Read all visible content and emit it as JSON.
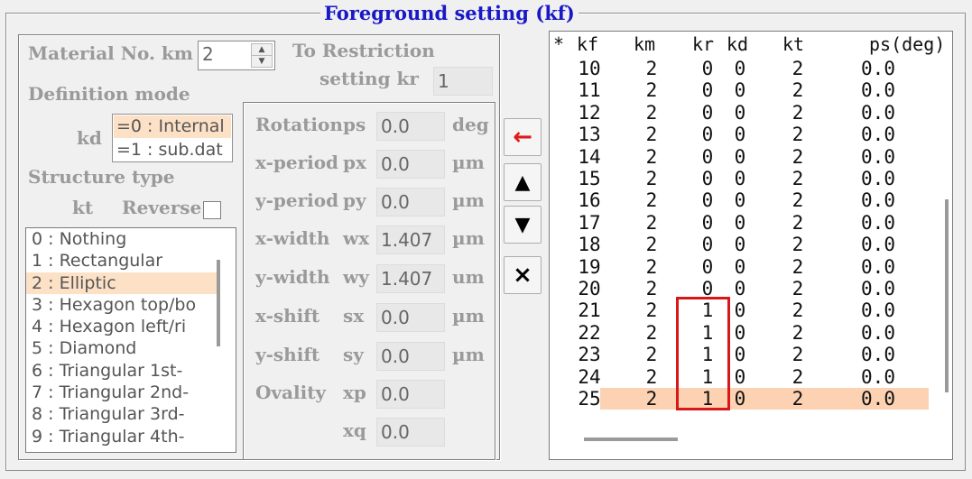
{
  "group_title": "Foreground setting (kf)",
  "material": {
    "label": "Material No.  km",
    "value": "2"
  },
  "restriction": {
    "label1": "To Restriction",
    "label2": "setting  kr",
    "value": "1"
  },
  "definition": {
    "label": "Definition mode",
    "kd_label": "kd",
    "opt0": "=0 : Internal",
    "opt1": "=1 : sub.dat"
  },
  "structure": {
    "label": "Structure type",
    "kt_label": "kt",
    "reverse_label": "Reverse"
  },
  "shape_list": [
    "0 : Nothing",
    "1 : Rectangular",
    "2 : Elliptic",
    "3 : Hexagon top/bo",
    "4 : Hexagon left/ri",
    "5 : Diamond",
    "6 : Triangular 1st-",
    "7 : Triangular 2nd-",
    "8 : Triangular 3rd-",
    "9 : Triangular 4th-"
  ],
  "params": [
    {
      "name": "Rotation",
      "sym": "ps",
      "value": "0.0",
      "unit": "deg"
    },
    {
      "name": "x-period",
      "sym": "px",
      "value": "0.0",
      "unit": "µm"
    },
    {
      "name": "y-period",
      "sym": "py",
      "value": "0.0",
      "unit": "µm"
    },
    {
      "name": "x-width",
      "sym": "wx",
      "value": "1.407",
      "unit": "µm"
    },
    {
      "name": "y-width",
      "sym": "wy",
      "value": "1.407",
      "unit": "um"
    },
    {
      "name": "x-shift",
      "sym": "sx",
      "value": "0.0",
      "unit": "µm"
    },
    {
      "name": "y-shift",
      "sym": "sy",
      "value": "0.0",
      "unit": "µm"
    },
    {
      "name": "Ovality",
      "sym": "xp",
      "value": "0.0",
      "unit": ""
    },
    {
      "name": "",
      "sym": "xq",
      "value": "0.0",
      "unit": ""
    }
  ],
  "buttons": {
    "left": "←",
    "up": "▲",
    "down": "▼",
    "delete": "×"
  },
  "table": {
    "headers": [
      "*",
      "kf",
      "km",
      "kr",
      "kd",
      "kt",
      "ps(deg)"
    ],
    "rows": [
      [
        "10",
        "2",
        "0",
        "0",
        "2",
        "0.0"
      ],
      [
        "11",
        "2",
        "0",
        "0",
        "2",
        "0.0"
      ],
      [
        "12",
        "2",
        "0",
        "0",
        "2",
        "0.0"
      ],
      [
        "13",
        "2",
        "0",
        "0",
        "2",
        "0.0"
      ],
      [
        "14",
        "2",
        "0",
        "0",
        "2",
        "0.0"
      ],
      [
        "15",
        "2",
        "0",
        "0",
        "2",
        "0.0"
      ],
      [
        "16",
        "2",
        "0",
        "0",
        "2",
        "0.0"
      ],
      [
        "17",
        "2",
        "0",
        "0",
        "2",
        "0.0"
      ],
      [
        "18",
        "2",
        "0",
        "0",
        "2",
        "0.0"
      ],
      [
        "19",
        "2",
        "0",
        "0",
        "2",
        "0.0"
      ],
      [
        "20",
        "2",
        "0",
        "0",
        "2",
        "0.0"
      ],
      [
        "21",
        "2",
        "1",
        "0",
        "2",
        "0.0"
      ],
      [
        "22",
        "2",
        "1",
        "0",
        "2",
        "0.0"
      ],
      [
        "23",
        "2",
        "1",
        "0",
        "2",
        "0.0"
      ],
      [
        "24",
        "2",
        "1",
        "0",
        "2",
        "0.0"
      ],
      [
        "25",
        "2",
        "1",
        "0",
        "2",
        "0.0"
      ]
    ],
    "selected_row": "25",
    "highlight_color": "#d81818"
  }
}
